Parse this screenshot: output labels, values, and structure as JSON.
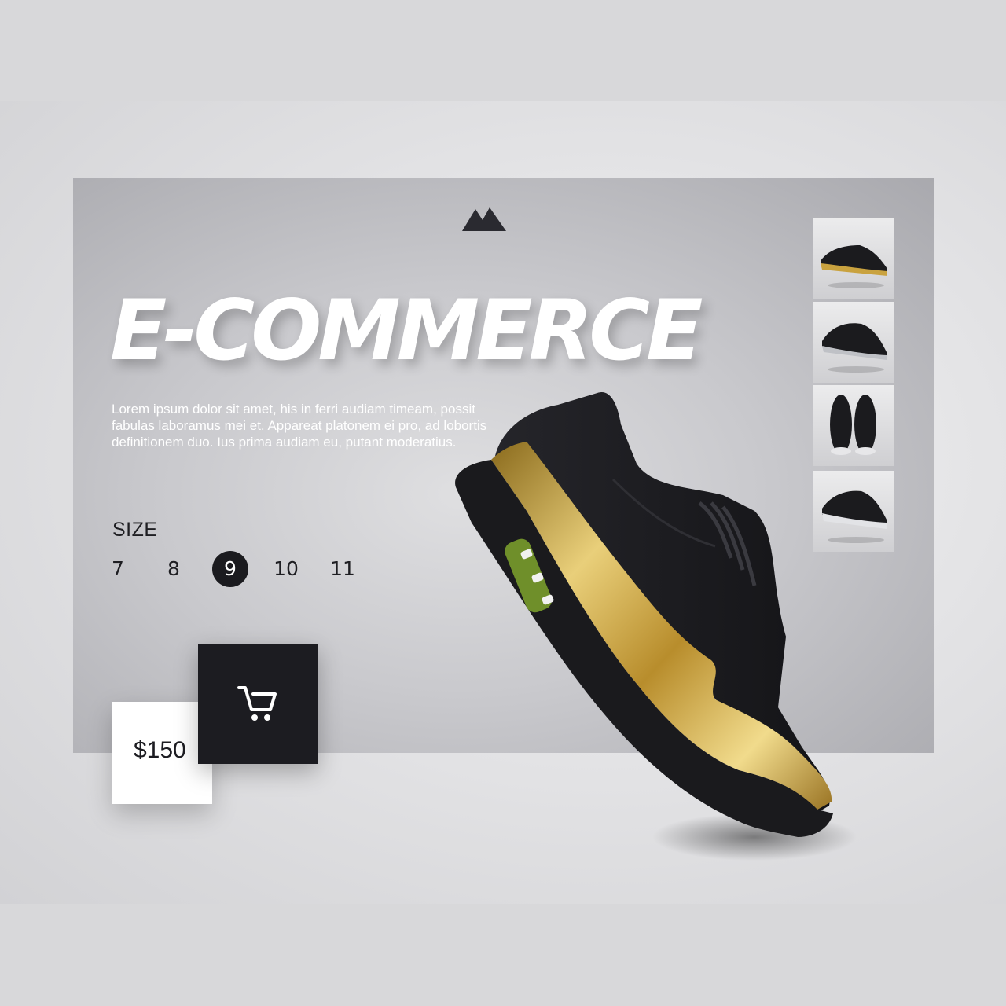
{
  "hero": {
    "logo_icon": "mountain-logo-icon",
    "title": "E-COMMERCE",
    "description": "Lorem ipsum dolor sit amet, his in ferri audiam timeam, possit fabulas laboramus mei et. Appareat platonem ei pro, ad lobortis definitionem duo. Ius prima audiam eu, putant moderatius."
  },
  "size": {
    "label": "SIZE",
    "options": [
      "7",
      "8",
      "9",
      "10",
      "11"
    ],
    "selected": "9"
  },
  "price": "$150",
  "cart": {
    "icon": "shopping-cart-icon"
  },
  "thumbnails": [
    {
      "view": "side view black and gold"
    },
    {
      "view": "side view black and silver"
    },
    {
      "view": "top view pair"
    },
    {
      "view": "side view black and white"
    }
  ],
  "colors": {
    "dark": "#1c1c21",
    "gold": "#c9a23f",
    "accent_green": "#8ab52a",
    "white": "#ffffff"
  }
}
